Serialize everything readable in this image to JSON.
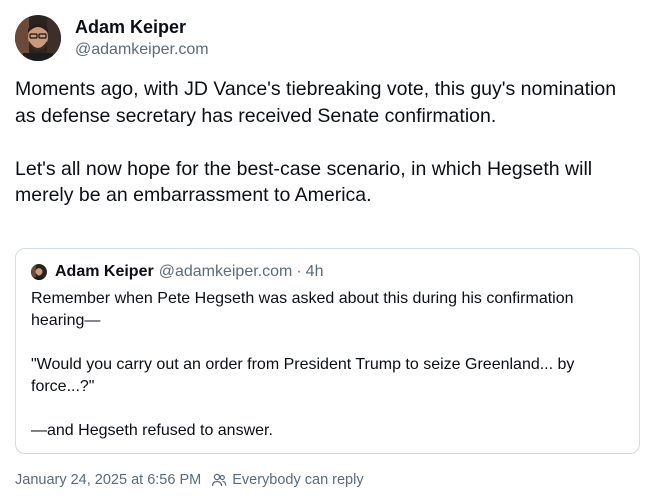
{
  "author": {
    "display_name": "Adam Keiper",
    "handle": "@adamkeiper.com"
  },
  "post": {
    "paragraphs": [
      "Moments ago, with JD Vance's tiebreaking vote, this guy's nomination as defense secretary has received Senate confirmation.",
      "Let's all now hope for the best-case scenario, in which Hegseth will merely be an embarrassment to America."
    ]
  },
  "quote": {
    "display_name": "Adam Keiper",
    "handle": "@adamkeiper.com",
    "separator": "·",
    "time": "4h",
    "paragraphs": [
      "Remember when Pete Hegseth was asked about this during his confirmation hearing—",
      "\"Would you carry out an order from President Trump to seize Greenland... by force...?\"",
      "—and Hegseth refused to answer."
    ]
  },
  "footer": {
    "timestamp": "January 24, 2025 at 6:56 PM",
    "reply_setting": "Everybody can reply",
    "reply_icon": "people-icon"
  }
}
